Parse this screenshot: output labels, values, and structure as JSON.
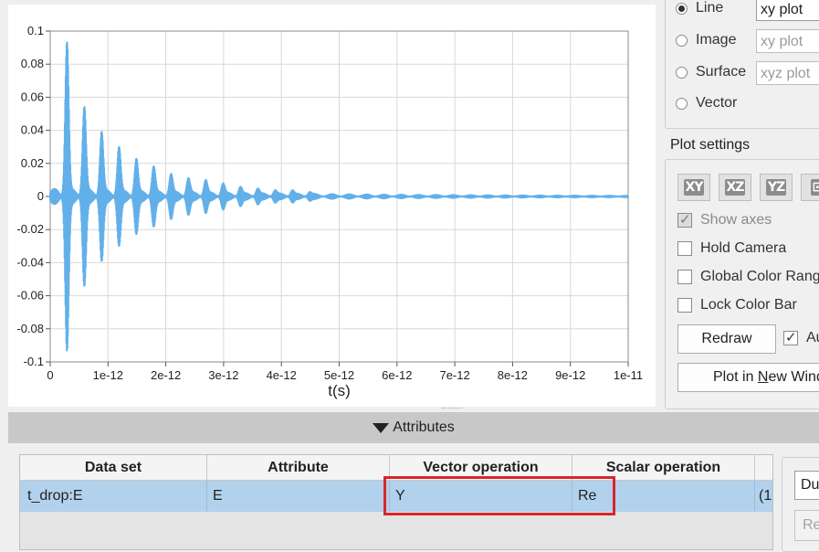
{
  "chart_data": {
    "type": "line",
    "xlabel": "t(s)",
    "ylabel": "",
    "xlim": [
      0,
      1e-11
    ],
    "ylim": [
      -0.1,
      0.1
    ],
    "x_ticks": [
      "0",
      "1e-12",
      "2e-12",
      "3e-12",
      "4e-12",
      "5e-12",
      "6e-12",
      "7e-12",
      "8e-12",
      "9e-12",
      "1e-11"
    ],
    "y_ticks": [
      "0.1",
      "0.08",
      "0.06",
      "0.04",
      "0.02",
      "0",
      "-0.02",
      "-0.04",
      "-0.06",
      "-0.08",
      "-0.1"
    ],
    "grid": true,
    "color": "#62b0ea",
    "series": [
      {
        "envelope_peaks": [
          {
            "t": 2.9e-13,
            "max": 0.091,
            "min": -0.092
          },
          {
            "t": 5.9e-13,
            "max": 0.052,
            "min": -0.053
          },
          {
            "t": 8.9e-13,
            "max": 0.037,
            "min": -0.038
          },
          {
            "t": 1.19e-12,
            "max": 0.028,
            "min": -0.029
          },
          {
            "t": 1.49e-12,
            "max": 0.021,
            "min": -0.022
          },
          {
            "t": 1.79e-12,
            "max": 0.017,
            "min": -0.017
          },
          {
            "t": 2.09e-12,
            "max": 0.012,
            "min": -0.013
          },
          {
            "t": 2.39e-12,
            "max": 0.01,
            "min": -0.01
          },
          {
            "t": 2.69e-12,
            "max": 0.009,
            "min": -0.009
          },
          {
            "t": 2.99e-12,
            "max": 0.007,
            "min": -0.007
          },
          {
            "t": 3.29e-12,
            "max": 0.005,
            "min": -0.005
          },
          {
            "t": 3.59e-12,
            "max": 0.004,
            "min": -0.004
          },
          {
            "t": 3.89e-12,
            "max": 0.003,
            "min": -0.003
          },
          {
            "t": 4.19e-12,
            "max": 0.003,
            "min": -0.003
          },
          {
            "t": 4.49e-12,
            "max": 0.002,
            "min": -0.002
          }
        ]
      }
    ]
  },
  "plot_type": {
    "options": [
      {
        "label": "Line",
        "selected": true,
        "combo": "xy plot",
        "combo_enabled": true
      },
      {
        "label": "Image",
        "selected": false,
        "combo": "xy plot",
        "combo_enabled": false
      },
      {
        "label": "Surface",
        "selected": false,
        "combo": "xyz plot",
        "combo_enabled": false
      },
      {
        "label": "Vector",
        "selected": false
      }
    ]
  },
  "plot_settings": {
    "title": "Plot settings",
    "view_buttons": [
      "XY",
      "XZ",
      "YZ",
      "⊡"
    ],
    "show_axes": "Show axes",
    "hold_camera": "Hold Camera",
    "global_color_range": "Global Color Rang",
    "lock_color_bar": "Lock Color Bar",
    "redraw": "Redraw",
    "auto": "Au",
    "plot_in_new_window_pre": "Plot in ",
    "plot_in_new_window_ul": "N",
    "plot_in_new_window_post": "ew Wind"
  },
  "attributes": {
    "header": "Attributes",
    "columns": [
      "Data set",
      "Attribute",
      "Vector operation",
      "Scalar operation"
    ],
    "rows": [
      {
        "data_set": "t_drop:E",
        "attribute": "E",
        "vector_op": "Y",
        "scalar_op": "Re",
        "extra": "(1e"
      }
    ],
    "side_combo": "Du",
    "side_button": "Re"
  }
}
